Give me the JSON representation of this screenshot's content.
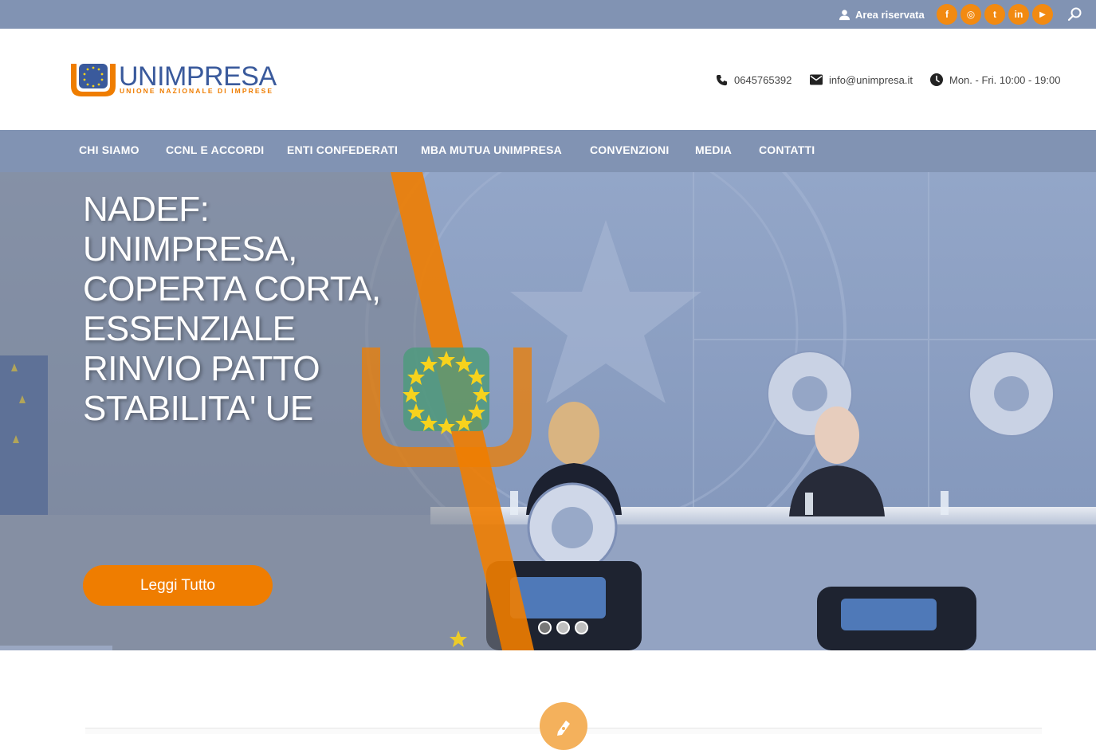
{
  "topbar": {
    "area_label": "Area riservata",
    "social": [
      {
        "name": "facebook",
        "glyph": "f"
      },
      {
        "name": "instagram",
        "glyph": "◎"
      },
      {
        "name": "twitter",
        "glyph": "t"
      },
      {
        "name": "linkedin",
        "glyph": "in"
      },
      {
        "name": "youtube",
        "glyph": "▶"
      }
    ]
  },
  "header": {
    "logo_name": "UNIMPRESA",
    "logo_tagline": "UNIONE NAZIONALE DI IMPRESE",
    "phone": "0645765392",
    "email": "info@unimpresa.it",
    "hours": "Mon. - Fri. 10:00 - 19:00"
  },
  "nav": {
    "items": [
      "CHI SIAMO",
      "CCNL E ACCORDI",
      "ENTI CONFEDERATI",
      "MBA MUTUA UNIMPRESA",
      "CONVENZIONI",
      "MEDIA",
      "CONTATTI"
    ]
  },
  "hero": {
    "title_lines": [
      "NADEF:",
      "UNIMPRESA,",
      "COPERTA CORTA,",
      "ESSENZIALE",
      "RINVIO PATTO",
      "STABILITA' UE"
    ],
    "button_label": "Leggi Tutto",
    "slides_count": 3,
    "active_slide": 1
  },
  "colors": {
    "bar_blue": "#8193b3",
    "accent_orange": "#ef7d00",
    "pen_orange": "#f4b15c"
  }
}
